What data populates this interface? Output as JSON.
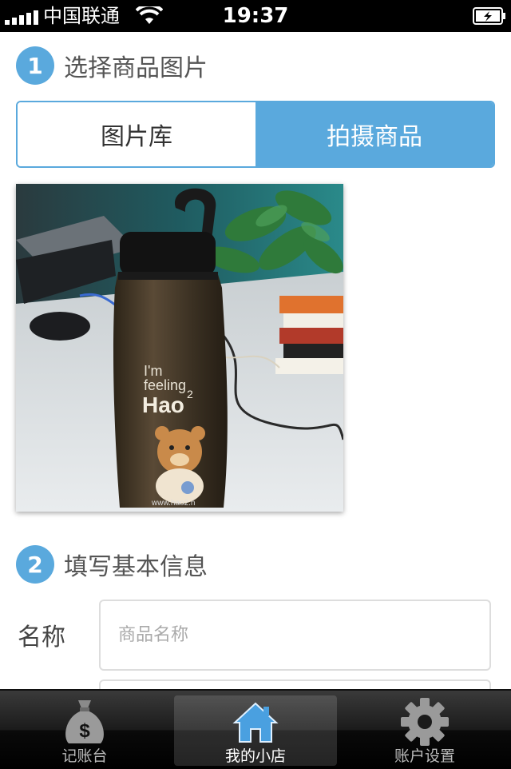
{
  "status_bar": {
    "carrier": "中国联通",
    "time": "19:37"
  },
  "section1": {
    "step": "1",
    "title": "选择商品图片"
  },
  "segmented": {
    "options": [
      "图片库",
      "拍摄商品"
    ],
    "selected": "拍摄商品"
  },
  "photo": {
    "subject": "water-bottle-photo",
    "bottle_text_line1": "I'm",
    "bottle_text_line2": "feeling",
    "bottle_text_line3": "Hao",
    "bottle_text_sup": "2",
    "bottle_url": "www.hao2.n"
  },
  "section2": {
    "step": "2",
    "title": "填写基本信息"
  },
  "form": {
    "name_label": "名称",
    "name_placeholder": "商品名称",
    "name_value": ""
  },
  "tabbar": {
    "items": [
      {
        "label": "记账台",
        "icon": "money-bag-icon"
      },
      {
        "label": "我的小店",
        "icon": "home-icon"
      },
      {
        "label": "账户设置",
        "icon": "gear-icon"
      }
    ],
    "active": "我的小店"
  },
  "colors": {
    "accent": "#5aa9dd",
    "statusbar": "#000000",
    "tabbar": "#1b1b1b"
  }
}
